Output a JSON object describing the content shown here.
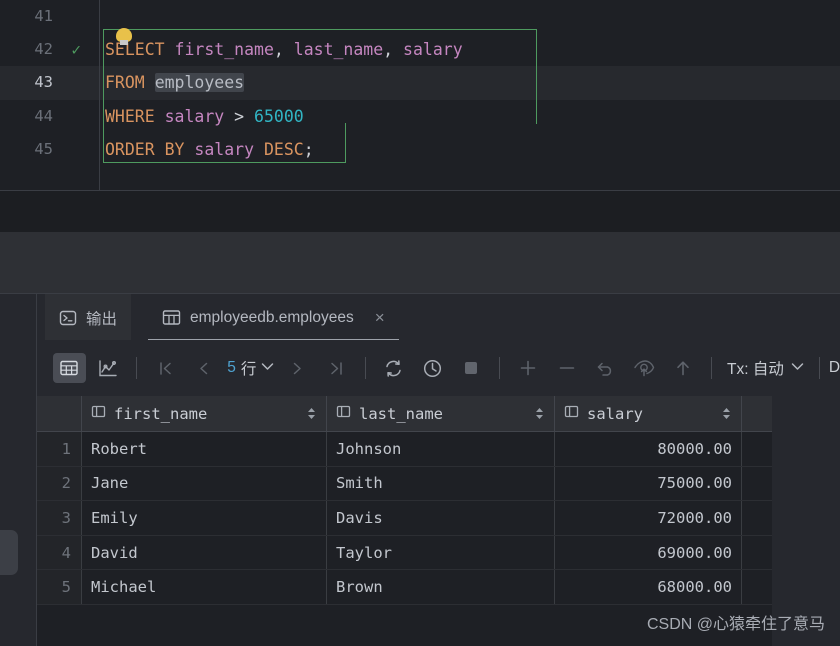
{
  "editor": {
    "lines": [
      {
        "number": "41",
        "current": false,
        "marker": "",
        "tokens": []
      },
      {
        "number": "42",
        "current": false,
        "marker": "check",
        "tokens": [
          {
            "t": "SELECT",
            "c": "kw"
          },
          {
            "t": " ",
            "c": "pun"
          },
          {
            "t": "first_name",
            "c": "col"
          },
          {
            "t": ", ",
            "c": "pun"
          },
          {
            "t": "last_name",
            "c": "col"
          },
          {
            "t": ", ",
            "c": "pun"
          },
          {
            "t": "salary",
            "c": "col"
          }
        ]
      },
      {
        "number": "43",
        "current": true,
        "marker": "",
        "tokens": [
          {
            "t": "FROM",
            "c": "kw"
          },
          {
            "t": " ",
            "c": "pun"
          },
          {
            "t": "employees",
            "c": "idhl"
          }
        ]
      },
      {
        "number": "44",
        "current": false,
        "marker": "",
        "tokens": [
          {
            "t": "WHERE",
            "c": "kw"
          },
          {
            "t": " ",
            "c": "pun"
          },
          {
            "t": "salary",
            "c": "col"
          },
          {
            "t": " ",
            "c": "pun"
          },
          {
            "t": ">",
            "c": "op"
          },
          {
            "t": " ",
            "c": "pun"
          },
          {
            "t": "65000",
            "c": "num2"
          }
        ]
      },
      {
        "number": "45",
        "current": false,
        "marker": "",
        "tokens": [
          {
            "t": "ORDER",
            "c": "kw"
          },
          {
            "t": " ",
            "c": "pun"
          },
          {
            "t": "BY",
            "c": "kw"
          },
          {
            "t": " ",
            "c": "pun"
          },
          {
            "t": "salary",
            "c": "col"
          },
          {
            "t": " ",
            "c": "pun"
          },
          {
            "t": "DESC",
            "c": "kw"
          },
          {
            "t": ";",
            "c": "pun"
          }
        ]
      }
    ],
    "gutter_marker_glyph": "✓",
    "intention_bulb": "lightbulb-icon"
  },
  "tabs": [
    {
      "id": "output",
      "label": "输出",
      "icon": "console-icon",
      "active": false,
      "closable": false
    },
    {
      "id": "table-result",
      "label": "employeedb.employees",
      "icon": "table-icon",
      "active": true,
      "closable": true,
      "close_glyph": "×"
    }
  ],
  "toolbar": {
    "view_grid_label": "grid-view",
    "view_chart_label": "chart-view",
    "first_page": "❘⟨",
    "prev_page": "⟨",
    "next_page": "⟩",
    "last_page": "⟩❘",
    "page_count_value": "5",
    "page_count_unit": "行",
    "page_dropdown_glyph": "⌄",
    "refresh": "refresh-icon",
    "history": "history-icon",
    "stop": "stop-icon",
    "add_row": "+",
    "delete_row": "−",
    "revert": "↶",
    "preview_submit": "preview-icon",
    "submit": "⇧",
    "tx_label": "Tx: 自动",
    "tx_dropdown_glyph": "⌄",
    "overflow_letter": "D"
  },
  "grid": {
    "row_number_header": "",
    "columns": [
      {
        "name": "first_name",
        "align": "left",
        "icon": "column-icon",
        "sortable": true
      },
      {
        "name": "last_name",
        "align": "left",
        "icon": "column-icon",
        "sortable": true
      },
      {
        "name": "salary",
        "align": "right",
        "icon": "column-icon",
        "sortable": true
      }
    ],
    "rows": [
      {
        "n": "1",
        "cells": [
          "Robert",
          "Johnson",
          "80000.00"
        ]
      },
      {
        "n": "2",
        "cells": [
          "Jane",
          "Smith",
          "75000.00"
        ]
      },
      {
        "n": "3",
        "cells": [
          "Emily",
          "Davis",
          "72000.00"
        ]
      },
      {
        "n": "4",
        "cells": [
          "David",
          "Taylor",
          "69000.00"
        ]
      },
      {
        "n": "5",
        "cells": [
          "Michael",
          "Brown",
          "68000.00"
        ]
      }
    ]
  },
  "watermark": {
    "text": "CSDN @心猿牵住了意马"
  },
  "colors": {
    "editor_bg": "#1E2025",
    "panel_bg": "#26282E",
    "header_bg": "#2E3035",
    "keyword": "#D99460",
    "column": "#C586C0",
    "number": "#31B5C4",
    "statement_outline": "#4E9A5F",
    "accent_blue": "#4FA3D1",
    "check_green": "#4E9A5F"
  }
}
